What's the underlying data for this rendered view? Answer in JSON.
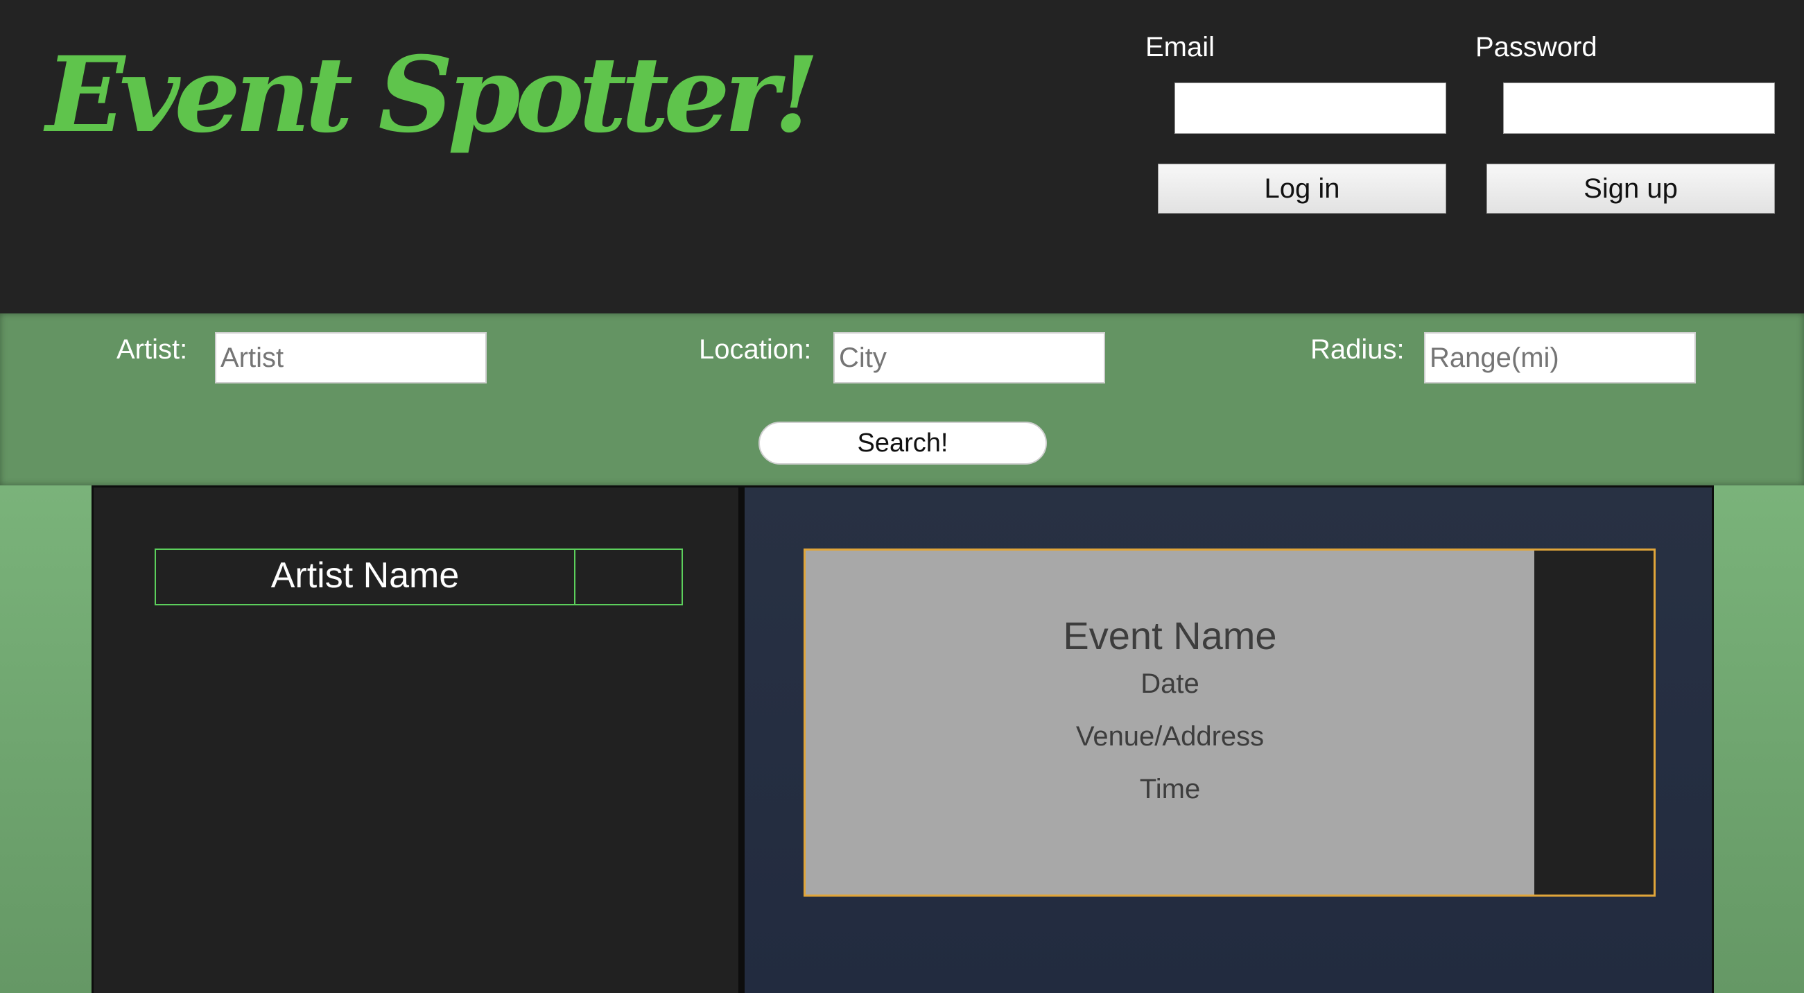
{
  "brand": {
    "logo_text": "Event Spotter!",
    "logo_color": "#5fc44c"
  },
  "auth": {
    "email_label": "Email",
    "email_value": "",
    "password_label": "Password",
    "password_value": "",
    "login_label": "Log in",
    "signup_label": "Sign up"
  },
  "search": {
    "artist_label": "Artist:",
    "artist_placeholder": "Artist",
    "location_label": "Location:",
    "location_placeholder": "City",
    "radius_label": "Radius:",
    "radius_placeholder": "Range(mi)",
    "submit_label": "Search!"
  },
  "artist_panel": {
    "artist_name": "Artist Name"
  },
  "event_panel": {
    "event_name": "Event Name",
    "date": "Date",
    "venue": "Venue/Address",
    "time": "Time"
  },
  "colors": {
    "header_bg": "#232323",
    "search_bar_bg": "#649463",
    "artist_border": "#5ccf5c",
    "event_border": "#e0a53a",
    "event_card_bg": "#a8a8a8",
    "right_panel_bg": "#283143"
  }
}
